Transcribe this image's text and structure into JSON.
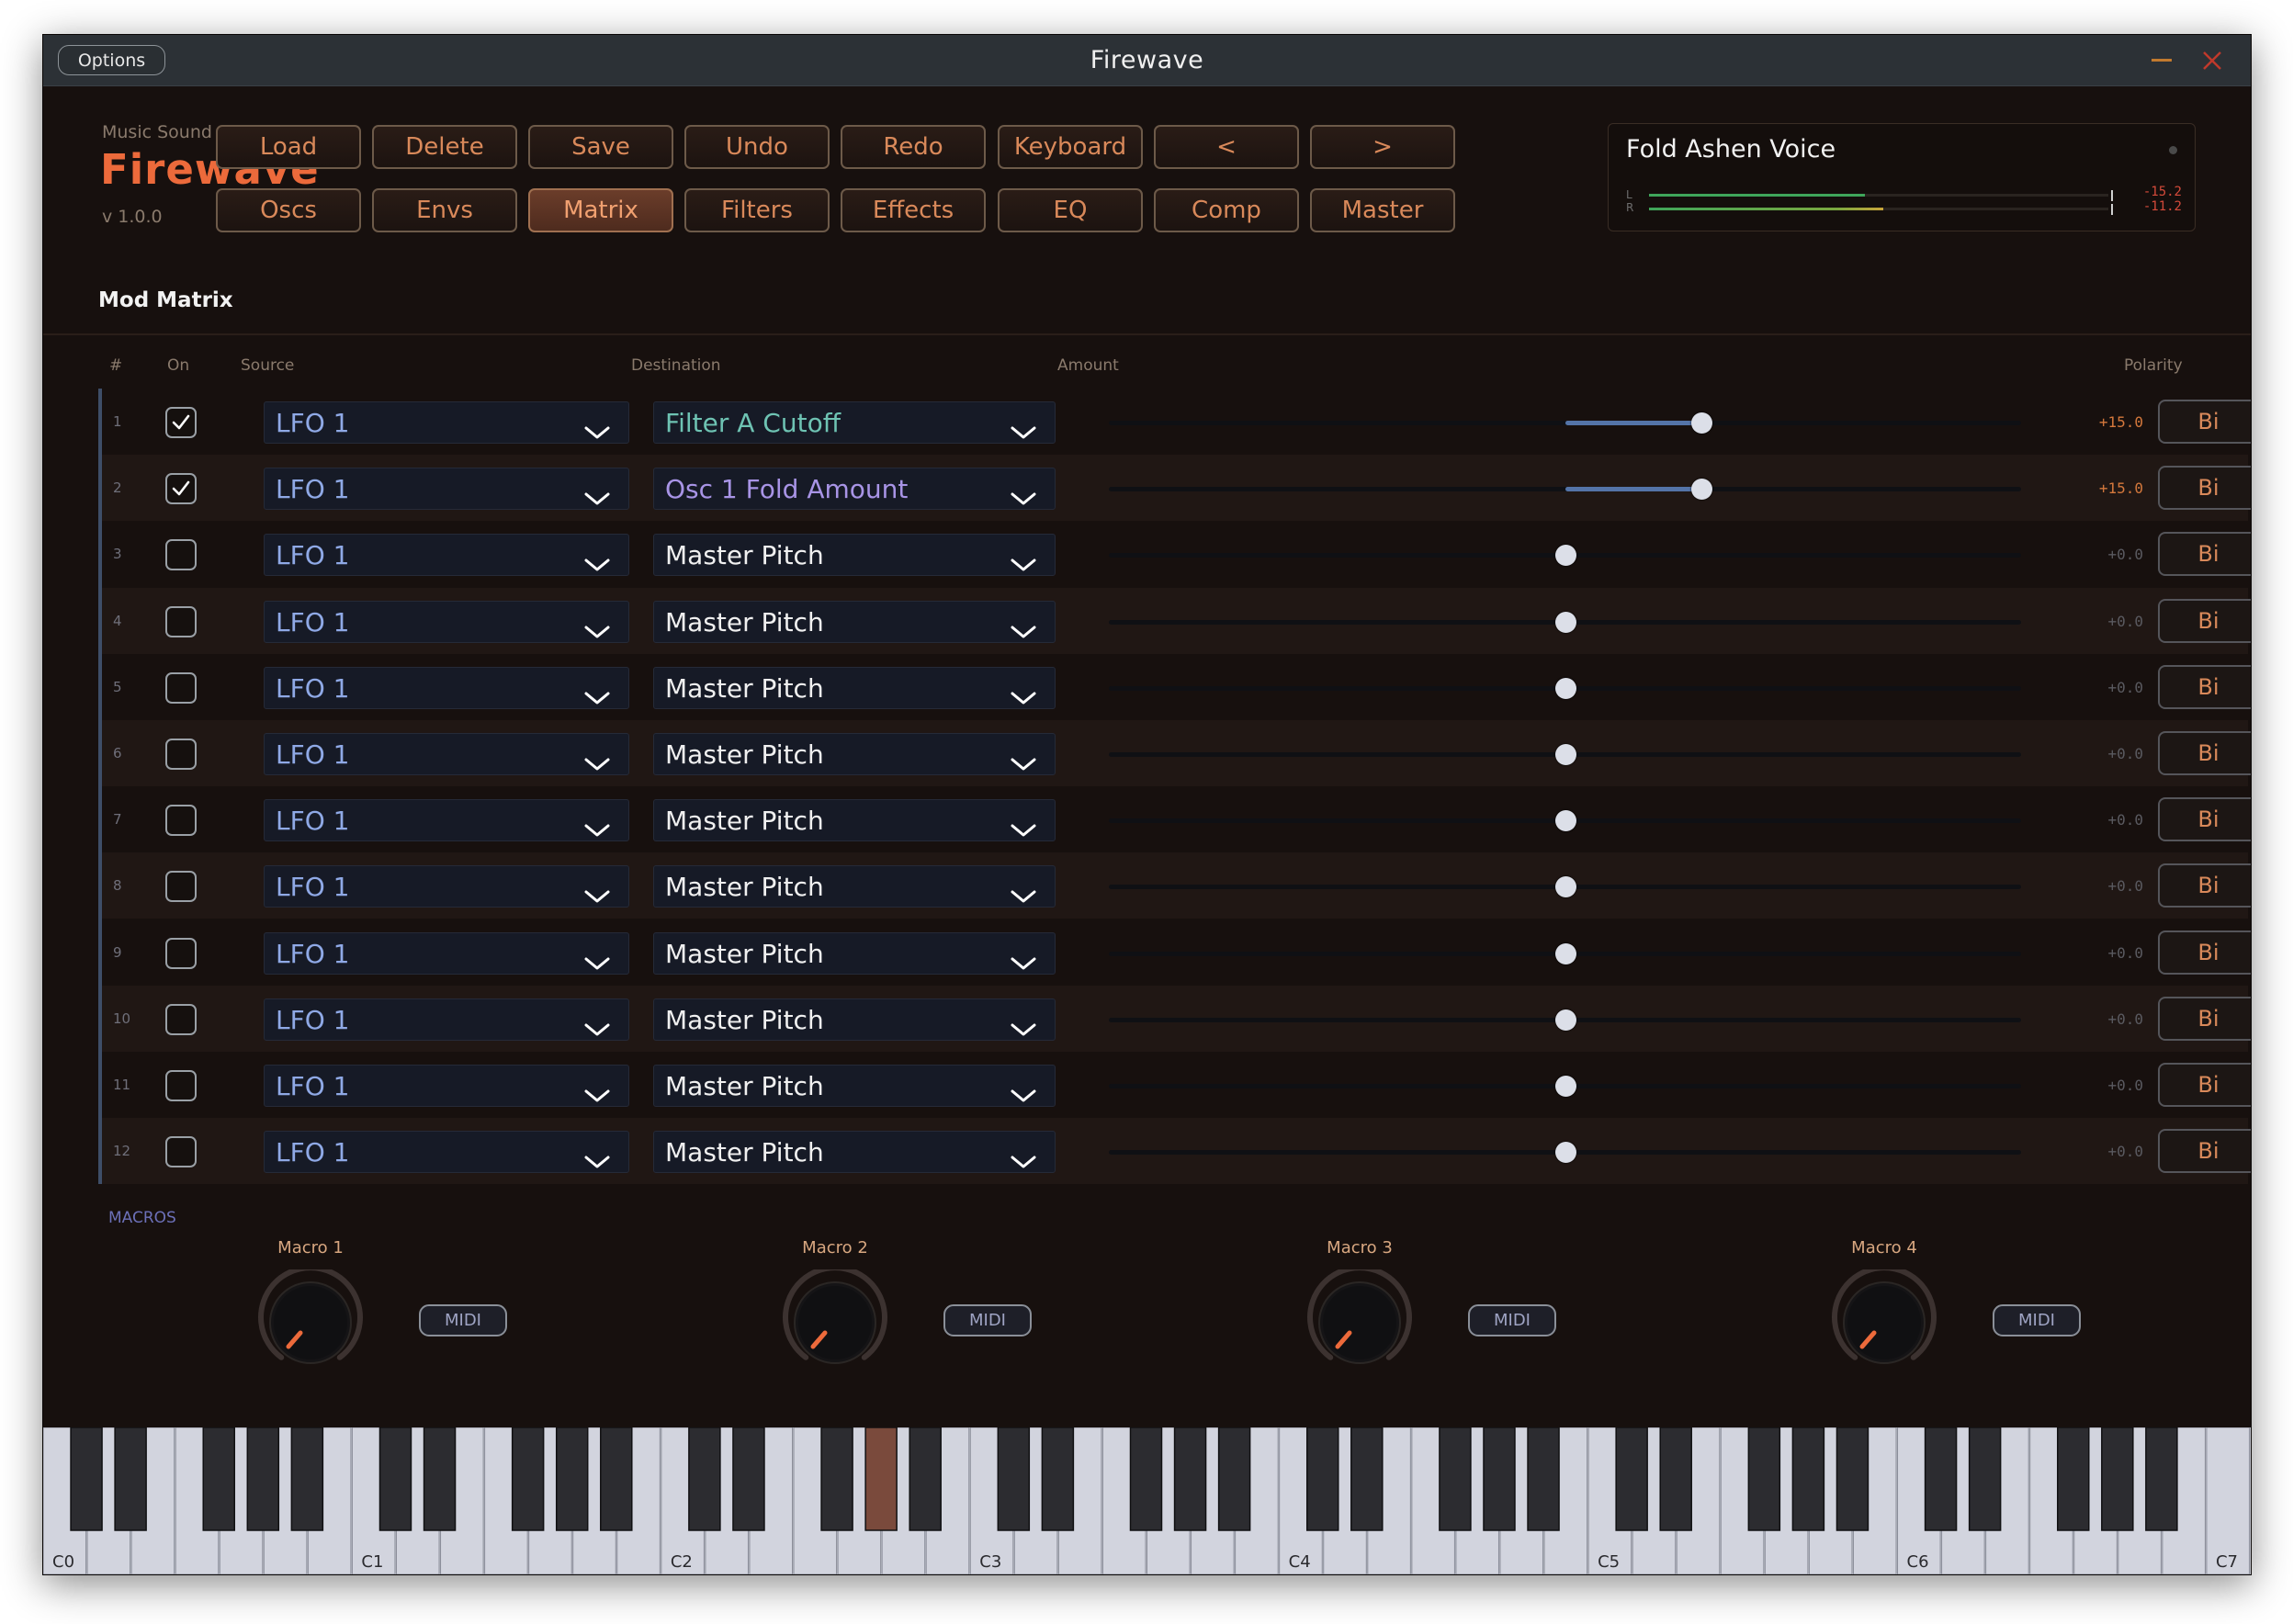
{
  "window": {
    "title": "Firewave",
    "options_label": "Options"
  },
  "brand": {
    "sub": "Music Sound Software",
    "logo": "Firewave",
    "version": "v 1.0.0"
  },
  "toolbar_top": [
    "Load",
    "Delete",
    "Save",
    "Undo",
    "Redo",
    "Keyboard",
    "<",
    ">"
  ],
  "toolbar_tabs": [
    "Oscs",
    "Envs",
    "Matrix",
    "Filters",
    "Effects",
    "EQ",
    "Comp",
    "Master"
  ],
  "active_tab": "Matrix",
  "preset": {
    "name": "Fold Ashen Voice",
    "meter_left_label": "L",
    "meter_right_label": "R",
    "meter_left_db": "-15.2",
    "meter_right_db": "-11.2",
    "meter_left_level": 0.47,
    "meter_right_level": 0.51
  },
  "section_title": "Mod Matrix",
  "columns": {
    "num": "#",
    "on": "On",
    "source": "Source",
    "destination": "Destination",
    "amount": "Amount",
    "polarity": "Polarity"
  },
  "rows": [
    {
      "num": "1",
      "on": true,
      "source": "LFO 1",
      "destination": "Filter A Cutoff",
      "dest_color": "teal",
      "amount": 0.15,
      "amount_text": "+15.0",
      "polarity": "Bi"
    },
    {
      "num": "2",
      "on": true,
      "source": "LFO 1",
      "destination": "Osc 1 Fold Amount",
      "dest_color": "purple",
      "amount": 0.15,
      "amount_text": "+15.0",
      "polarity": "Bi"
    },
    {
      "num": "3",
      "on": false,
      "source": "LFO 1",
      "destination": "Master Pitch",
      "dest_color": "white",
      "amount": 0,
      "amount_text": "+0.0",
      "polarity": "Bi"
    },
    {
      "num": "4",
      "on": false,
      "source": "LFO 1",
      "destination": "Master Pitch",
      "dest_color": "white",
      "amount": 0,
      "amount_text": "+0.0",
      "polarity": "Bi"
    },
    {
      "num": "5",
      "on": false,
      "source": "LFO 1",
      "destination": "Master Pitch",
      "dest_color": "white",
      "amount": 0,
      "amount_text": "+0.0",
      "polarity": "Bi"
    },
    {
      "num": "6",
      "on": false,
      "source": "LFO 1",
      "destination": "Master Pitch",
      "dest_color": "white",
      "amount": 0,
      "amount_text": "+0.0",
      "polarity": "Bi"
    },
    {
      "num": "7",
      "on": false,
      "source": "LFO 1",
      "destination": "Master Pitch",
      "dest_color": "white",
      "amount": 0,
      "amount_text": "+0.0",
      "polarity": "Bi"
    },
    {
      "num": "8",
      "on": false,
      "source": "LFO 1",
      "destination": "Master Pitch",
      "dest_color": "white",
      "amount": 0,
      "amount_text": "+0.0",
      "polarity": "Bi"
    },
    {
      "num": "9",
      "on": false,
      "source": "LFO 1",
      "destination": "Master Pitch",
      "dest_color": "white",
      "amount": 0,
      "amount_text": "+0.0",
      "polarity": "Bi"
    },
    {
      "num": "10",
      "on": false,
      "source": "LFO 1",
      "destination": "Master Pitch",
      "dest_color": "white",
      "amount": 0,
      "amount_text": "+0.0",
      "polarity": "Bi"
    },
    {
      "num": "11",
      "on": false,
      "source": "LFO 1",
      "destination": "Master Pitch",
      "dest_color": "white",
      "amount": 0,
      "amount_text": "+0.0",
      "polarity": "Bi"
    },
    {
      "num": "12",
      "on": false,
      "source": "LFO 1",
      "destination": "Master Pitch",
      "dest_color": "white",
      "amount": 0,
      "amount_text": "+0.0",
      "polarity": "Bi"
    }
  ],
  "macros_title": "MACROS",
  "macros": [
    {
      "label": "Macro 1",
      "value": "0.00",
      "midi_label": "MIDI"
    },
    {
      "label": "Macro 2",
      "value": "0.00",
      "midi_label": "MIDI"
    },
    {
      "label": "Macro 3",
      "value": "0.00",
      "midi_label": "MIDI"
    },
    {
      "label": "Macro 4",
      "value": "0.00",
      "midi_label": "MIDI"
    }
  ],
  "keyboard": {
    "octave_labels": [
      "C0",
      "C1",
      "C2",
      "C3",
      "C4",
      "C5",
      "C6",
      "C7"
    ],
    "pressed_note": "G#2"
  },
  "colors": {
    "accent": "#ec6a3b",
    "button_text": "#d9895a",
    "source_text": "#8fa9e6",
    "dest_teal": "#6ec3b3",
    "dest_purple": "#a894e6",
    "slider_fill": "#5474a8",
    "pressed_key": "#7a4a3c"
  }
}
